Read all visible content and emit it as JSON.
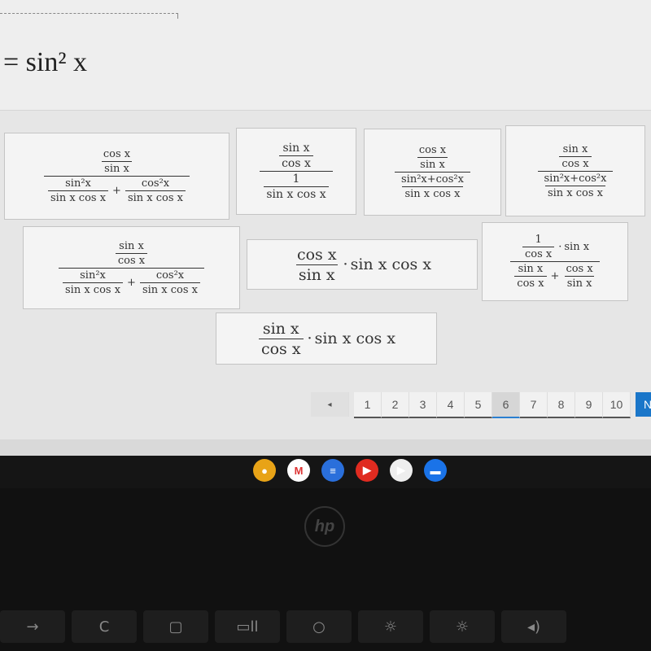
{
  "equation": {
    "text": "= sin² x"
  },
  "tiles": [
    {
      "size": 13,
      "expr": {
        "frac": [
          {
            "frac": [
              "cos x",
              "sin x"
            ]
          },
          {
            "row": [
              {
                "frac": [
                  "sin²x",
                  "sin x cos x"
                ]
              },
              {
                "op": "+"
              },
              {
                "frac": [
                  "cos²x",
                  "sin x cos x"
                ]
              }
            ]
          }
        ]
      }
    },
    {
      "size": 14,
      "expr": {
        "frac": [
          {
            "frac": [
              "sin x",
              "cos x"
            ]
          },
          {
            "frac": [
              "1",
              "sin x cos x"
            ]
          }
        ]
      }
    },
    {
      "size": 13,
      "expr": {
        "frac": [
          {
            "frac": [
              "cos x",
              "sin x"
            ]
          },
          {
            "frac": [
              "sin²x+cos²x",
              "sin x cos x"
            ]
          }
        ]
      }
    },
    {
      "size": 13,
      "expr": {
        "frac": [
          {
            "frac": [
              "sin x",
              "cos x"
            ]
          },
          {
            "frac": [
              "sin²x+cos²x",
              "sin x cos x"
            ]
          }
        ]
      }
    },
    {
      "size": 13,
      "expr": {
        "frac": [
          {
            "frac": [
              "sin x",
              "cos x"
            ]
          },
          {
            "row": [
              {
                "frac": [
                  "sin²x",
                  "sin x cos x"
                ]
              },
              {
                "op": "+"
              },
              {
                "frac": [
                  "cos²x",
                  "sin x cos x"
                ]
              }
            ]
          }
        ]
      }
    },
    {
      "size": 19,
      "expr": {
        "row": [
          {
            "frac": [
              "cos x",
              "sin x"
            ]
          },
          {
            "op": "·"
          },
          "sin x cos x"
        ]
      }
    },
    {
      "size": 13,
      "expr": {
        "frac": [
          {
            "row": [
              {
                "frac": [
                  "1",
                  "cos x"
                ]
              },
              {
                "op": "·"
              },
              "sin x"
            ]
          },
          {
            "row": [
              {
                "frac": [
                  "sin x",
                  "cos x"
                ]
              },
              {
                "op": "+"
              },
              {
                "frac": [
                  "cos x",
                  "sin x"
                ]
              }
            ]
          }
        ]
      }
    },
    {
      "size": 19,
      "expr": {
        "row": [
          {
            "frac": [
              "sin x",
              "cos x"
            ]
          },
          {
            "op": "·"
          },
          "sin x cos x"
        ]
      }
    }
  ],
  "pagination": {
    "prev": "◂",
    "pages": [
      "1",
      "2",
      "3",
      "4",
      "5",
      "6",
      "7",
      "8",
      "9",
      "10"
    ],
    "current": "6",
    "next": "N"
  },
  "shelf": [
    {
      "name": "chrome",
      "color": "#e8a317",
      "glyph": "●"
    },
    {
      "name": "gmail",
      "color": "#ffffff",
      "glyph": "M"
    },
    {
      "name": "docs",
      "color": "#2a6fdb",
      "glyph": "≡"
    },
    {
      "name": "youtube",
      "color": "#e02b20",
      "glyph": "▶"
    },
    {
      "name": "play-store",
      "color": "#eeeeee",
      "glyph": "▶"
    },
    {
      "name": "files",
      "color": "#1a73e8",
      "glyph": "▬"
    }
  ],
  "brand": "hp",
  "keys": [
    "→",
    "C",
    "▢",
    "▭ll",
    "○",
    "☼",
    "☼",
    "◂)"
  ]
}
